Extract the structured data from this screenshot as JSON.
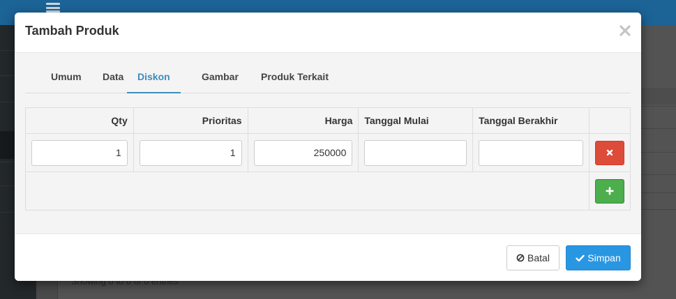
{
  "background": {
    "footer_text": "Showing 0 to 0 of 0 entries"
  },
  "modal": {
    "title": "Tambah Produk",
    "close_icon": "close-icon"
  },
  "tabs": [
    {
      "label": "Umum",
      "active": false
    },
    {
      "label": "Data",
      "active": false
    },
    {
      "label": "Diskon",
      "active": true
    },
    {
      "label": "Gambar",
      "active": false
    },
    {
      "label": "Produk Terkait",
      "active": false
    }
  ],
  "discount_table": {
    "headers": {
      "qty": "Qty",
      "prioritas": "Prioritas",
      "harga": "Harga",
      "tanggal_mulai": "Tanggal Mulai",
      "tanggal_berakhir": "Tanggal Berakhir"
    },
    "rows": [
      {
        "qty": "1",
        "prioritas": "1",
        "harga": "250000",
        "tanggal_mulai": "",
        "tanggal_berakhir": "",
        "remove_icon": "times-icon"
      }
    ],
    "add_icon": "plus-icon"
  },
  "footer": {
    "cancel_label": "Batal",
    "cancel_icon": "ban-icon",
    "save_label": "Simpan",
    "save_icon": "check-icon"
  },
  "colors": {
    "accent": "#3c8dbc",
    "primary_button": "#2996e2",
    "danger_button": "#dd4b39",
    "success_button": "#4cae4c"
  }
}
